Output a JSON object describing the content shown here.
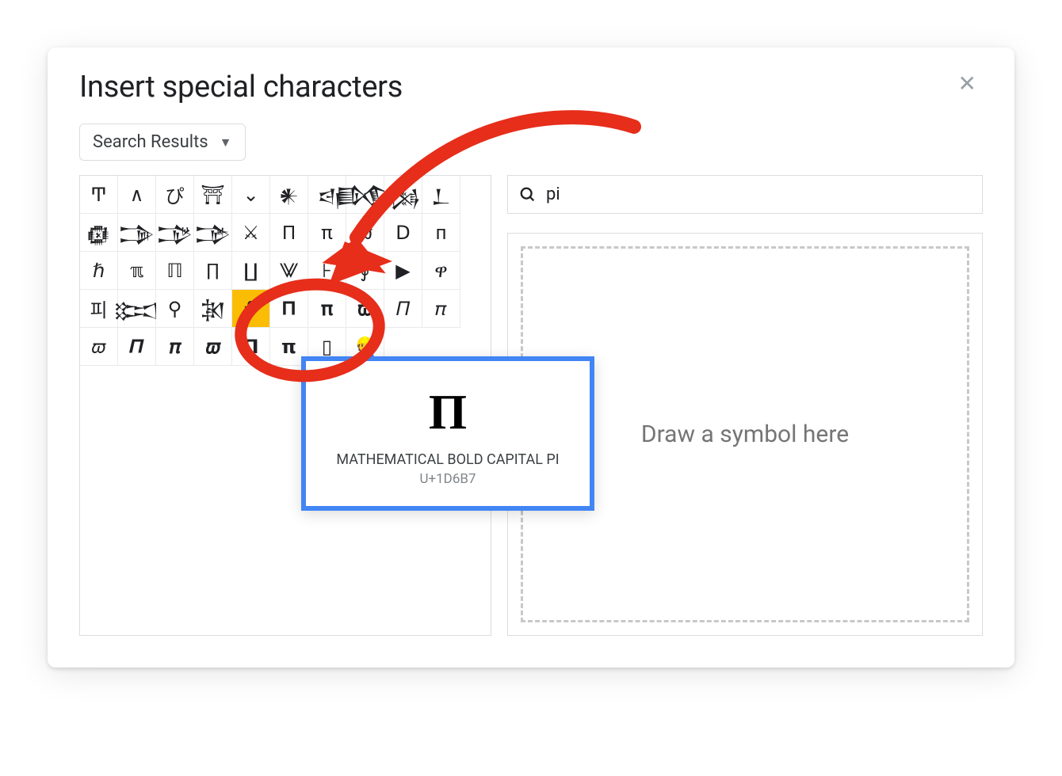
{
  "dialog": {
    "title": "Insert special characters",
    "close_label": "✕",
    "dropdown_label": "Search Results"
  },
  "search": {
    "value": "pi"
  },
  "draw_hint": "Draw a symbol here",
  "tooltip": {
    "glyph": "Π",
    "name": "MATHEMATICAL BOLD CAPITAL PI",
    "code": "U+1D6B7"
  },
  "grid": {
    "highlighted_index": 34,
    "chars": [
      "Ͳ",
      "∧",
      "ぴ",
      "⛩",
      "⌄",
      "𒀭",
      "𒁀",
      "𒁃",
      "𒁆",
      "𒁇",
      "𒁈",
      "𒁊",
      "𒁋",
      "𒁌",
      "⚔",
      "Π",
      "π",
      "ϖ",
      "Ⅾ",
      "п",
      "ℏ",
      "ℼ",
      "ℿ",
      "∏",
      "∐",
      "⨈",
      "⊦",
      "∮",
      "▶",
      "ዋ",
      "피",
      "𒁎",
      "⚲",
      "𒁐",
      "⚘",
      "𝚷",
      "𝛑",
      "𝛡",
      "𝛱",
      "𝜋",
      "𝜛",
      "𝜫",
      "𝝅",
      "𝝕",
      "𝝥",
      "𝝿",
      "",
      "",
      "",
      "",
      "▯",
      "👷",
      "",
      "",
      "",
      "",
      "",
      "",
      "",
      ""
    ]
  }
}
